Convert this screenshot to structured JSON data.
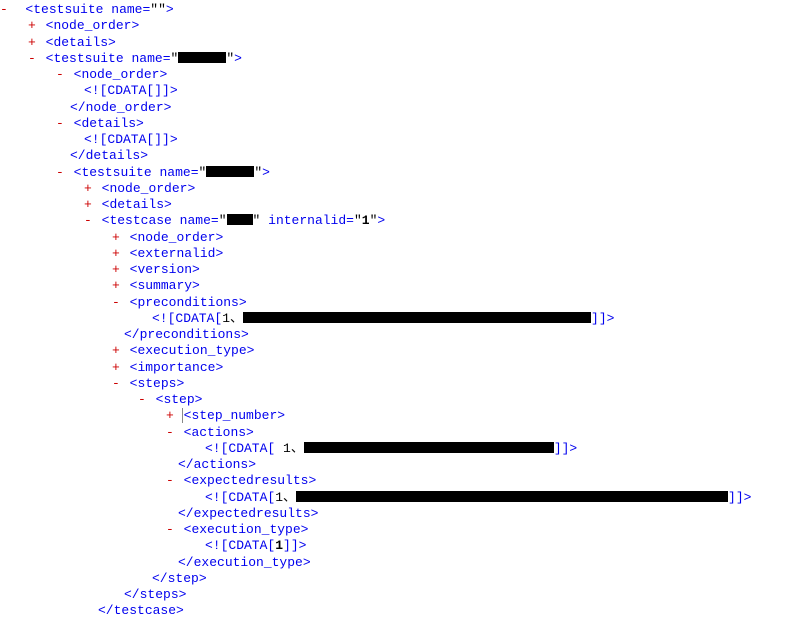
{
  "sym": {
    "minus": "-",
    "plus": "+",
    "lt": "<",
    "ltc": "</",
    "gt": ">",
    "eq": "=",
    "q": "\"",
    "cdo": "<![CDATA[",
    "cdc": "]]>",
    "spc": " "
  },
  "tags": {
    "testsuite": "testsuite",
    "name": "name",
    "node_order": "node_order",
    "details": "details",
    "testcase": "testcase",
    "internalid": "internalid",
    "externalid": "externalid",
    "version": "version",
    "summary": "summary",
    "preconditions": "preconditions",
    "execution_type": "execution_type",
    "importance": "importance",
    "steps": "steps",
    "step": "step",
    "step_number": "step_number",
    "actions": "actions",
    "expectedresults": "expectedresults"
  },
  "vals": {
    "empty": "",
    "one": "1",
    "one_caret": "1、",
    "space1": " 1、"
  }
}
